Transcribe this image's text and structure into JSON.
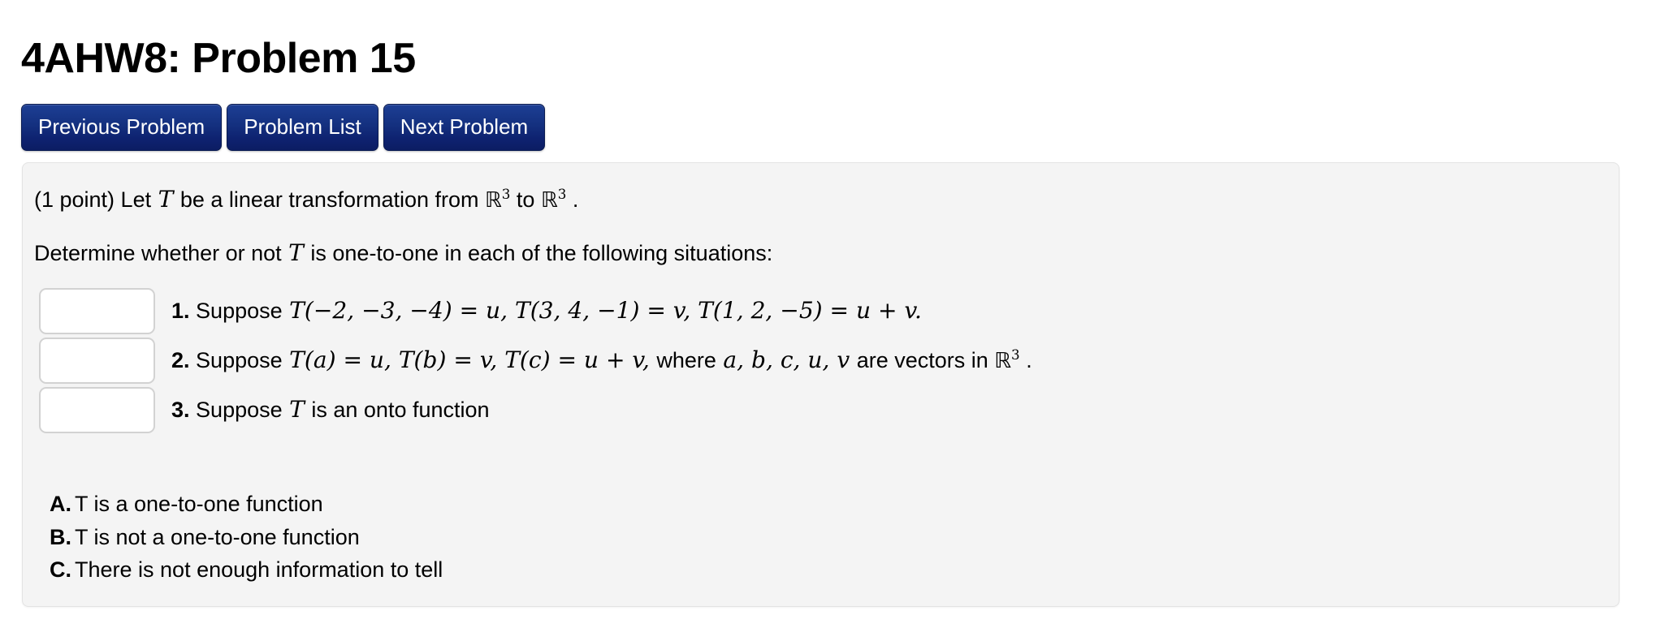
{
  "header": {
    "title": "4AHW8: Problem 15"
  },
  "nav": {
    "buttons": [
      {
        "label": "Previous Problem",
        "name": "previous-problem-button"
      },
      {
        "label": "Problem List",
        "name": "problem-list-button"
      },
      {
        "label": "Next Problem",
        "name": "next-problem-button"
      }
    ],
    "color": "#14307f"
  },
  "problem": {
    "points": "(1 point)",
    "intro_pre": "(1 point) Let ",
    "intro_T": "T",
    "intro_mid": " be a linear transformation from ",
    "domain_set": "ℝ",
    "domain_exp": "3",
    "intro_to": " to ",
    "codomain_set": "ℝ",
    "codomain_exp": "3",
    "intro_end": " .",
    "question_pre": "Determine whether or not ",
    "question_T": "T",
    "question_post": " is one-to-one in each of the following situations:",
    "items": [
      {
        "number": "1.",
        "lead": "Suppose ",
        "math": "T(−2, −3, −4) = u, T(3, 4, −1) = v, T(1, 2, −5) = u + v.",
        "tail": "",
        "answer_value": "",
        "answer_placeholder": ""
      },
      {
        "number": "2.",
        "lead": "Suppose ",
        "math": "T(a) = u, T(b) = v, T(c) = u + v,",
        "tail_pre": " where ",
        "tail_math": "a, b, c, u, v",
        "tail_mid": " are vectors in ",
        "tail_set": "ℝ",
        "tail_exp": "3",
        "tail_end": " .",
        "answer_value": "",
        "answer_placeholder": ""
      },
      {
        "number": "3.",
        "lead": "Suppose ",
        "math": "T",
        "tail": " is an onto function",
        "answer_value": "",
        "answer_placeholder": ""
      }
    ],
    "choices": [
      {
        "letter": "A.",
        "text": "T is a one-to-one function"
      },
      {
        "letter": "B.",
        "text": "T is not a one-to-one function"
      },
      {
        "letter": "C.",
        "text": "There is not enough information to tell"
      }
    ]
  }
}
